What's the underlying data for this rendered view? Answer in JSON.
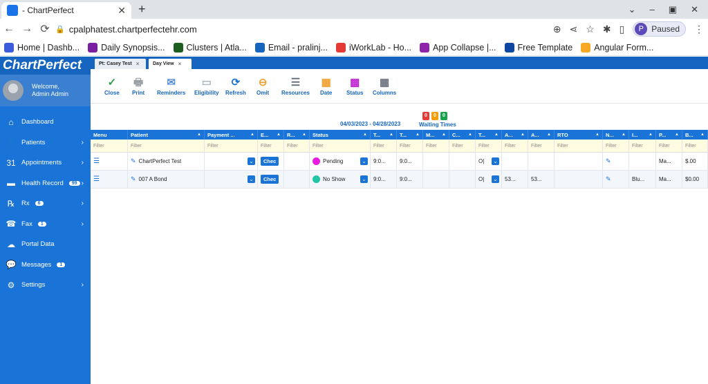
{
  "browser": {
    "tab_title": "- ChartPerfect",
    "url": "cpalphatest.chartperfectehr.com",
    "paused_label": "Paused",
    "profile_initial": "P",
    "bookmarks": [
      {
        "label": "Home | Dashb...",
        "color": "#3b5bdb"
      },
      {
        "label": "Daily Synopsis...",
        "color": "#7b1fa2"
      },
      {
        "label": "Clusters | Atla...",
        "color": "#1b5e20"
      },
      {
        "label": "Email - pralinj...",
        "color": "#1565c0"
      },
      {
        "label": "iWorkLab - Ho...",
        "color": "#e53935"
      },
      {
        "label": "App Collapse |...",
        "color": "#8e24aa"
      },
      {
        "label": "Free Template",
        "color": "#0d47a1"
      },
      {
        "label": "Angular Form...",
        "color": "#f9a825"
      }
    ]
  },
  "app": {
    "logo": "ChartPerfect",
    "welcome_line1": "Welcome,",
    "welcome_line2": "Admin Admin",
    "menu": [
      {
        "label": "Dashboard",
        "icon": "home-icon",
        "glyph": "⌂",
        "badge": "",
        "chevron": ""
      },
      {
        "label": "Patients",
        "icon": "person-icon",
        "glyph": "👤",
        "badge": "",
        "chevron": "›"
      },
      {
        "label": "Appointments",
        "icon": "calendar-icon",
        "glyph": "31",
        "badge": "",
        "chevron": "›"
      },
      {
        "label": "Health Record",
        "icon": "folder-icon",
        "glyph": "▬",
        "badge": "99",
        "chevron": "›"
      },
      {
        "label": "Rx",
        "icon": "rx-icon",
        "glyph": "℞",
        "badge": "6",
        "chevron": "›"
      },
      {
        "label": "Fax",
        "icon": "fax-icon",
        "glyph": "☎",
        "badge": "1",
        "chevron": "›"
      },
      {
        "label": "Portal Data",
        "icon": "cloud-icon",
        "glyph": "☁",
        "badge": "",
        "chevron": ""
      },
      {
        "label": "Messages",
        "icon": "chat-icon",
        "glyph": "💬",
        "badge": "1",
        "chevron": ""
      },
      {
        "label": "Settings",
        "icon": "gear-icon",
        "glyph": "⚙",
        "badge": "",
        "chevron": "›"
      }
    ],
    "tabs": [
      {
        "label": "Pt: Casey Test"
      },
      {
        "label": "Day View"
      }
    ],
    "actions": [
      {
        "label": "Close",
        "icon": "check-icon",
        "glyph": "✓",
        "color": "#2e9e44"
      },
      {
        "label": "Print",
        "icon": "printer-icon",
        "glyph": "🖶",
        "color": "#9aa0a6"
      },
      {
        "label": "Reminders",
        "icon": "reminders-icon",
        "glyph": "✉",
        "color": "#5a8fd8"
      },
      {
        "label": "Eligibility",
        "icon": "eligibility-icon",
        "glyph": "▭",
        "color": "#b0b6bd"
      },
      {
        "label": "Refresh",
        "icon": "refresh-icon",
        "glyph": "⟳",
        "color": "#1a73d6"
      },
      {
        "label": "Omit",
        "icon": "omit-icon",
        "glyph": "⊖",
        "color": "#f0a030"
      },
      {
        "label": "Resources",
        "icon": "sliders-icon",
        "glyph": "☰",
        "color": "#6b7280"
      },
      {
        "label": "Date",
        "icon": "date-icon",
        "glyph": "▦",
        "color": "#f0a030"
      },
      {
        "label": "Status",
        "icon": "status-icon",
        "glyph": "▩",
        "color": "#c026d3"
      },
      {
        "label": "Columns",
        "icon": "columns-icon",
        "glyph": "▦",
        "color": "#6b7280"
      }
    ],
    "date_range": "04/03/2023 - 04/28/2023",
    "waiting_times_label": "Waiting Times",
    "waiting_boxes": [
      {
        "value": "0",
        "color": "#e53935"
      },
      {
        "value": "0",
        "color": "#f59e0b"
      },
      {
        "value": "0",
        "color": "#16a34a"
      }
    ],
    "grid": {
      "filter_placeholder": "Filter",
      "columns": [
        "Menu",
        "Patient",
        "Payment ...",
        "E...",
        "R...",
        "Status",
        "T...",
        "T...",
        "M...",
        "C...",
        "T...",
        "A...",
        "A...",
        "RTO",
        "N...",
        "I...",
        "P...",
        "B..."
      ],
      "rows": [
        {
          "patient": "ChartPerfect Test",
          "check": "Chec",
          "status": "Pending",
          "status_color": "#e81ce0",
          "t1": "9:0...",
          "t2": "9:0...",
          "t5": "O|",
          "a1": "",
          "a2": "",
          "i": "",
          "p": "Ma...",
          "b": "$.00"
        },
        {
          "patient": "007 A Bond",
          "check": "Chec",
          "status": "No Show",
          "status_color": "#22c4a8",
          "t1": "9:0...",
          "t2": "9:0...",
          "t5": "O|",
          "a1": "53...",
          "a2": "53...",
          "i": "Blu...",
          "p": "Ma...",
          "b": "$0.00"
        }
      ]
    }
  }
}
